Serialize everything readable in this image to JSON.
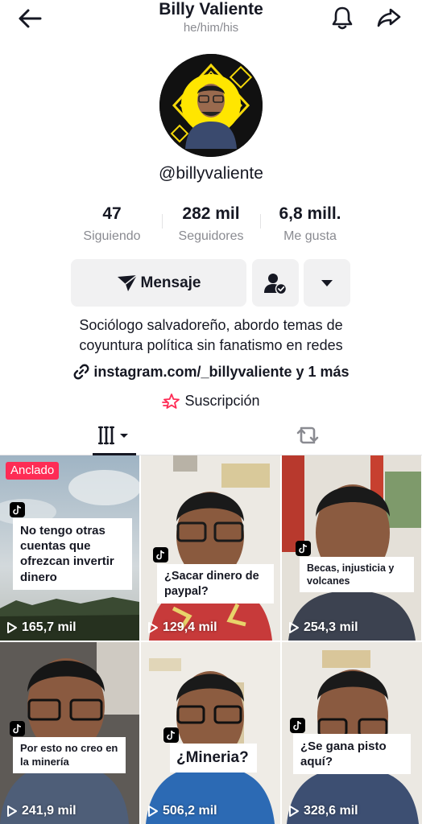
{
  "header": {
    "title": "Billy Valiente",
    "pronouns": "he/him/his",
    "back_icon": "arrow-left-icon",
    "bell_icon": "bell-icon",
    "share_icon": "share-arrow-icon"
  },
  "profile": {
    "username": "@billyvaliente",
    "stats": [
      {
        "value": "47",
        "label": "Siguiendo"
      },
      {
        "value": "282 mil",
        "label": "Seguidores"
      },
      {
        "value": "6,8 mill.",
        "label": "Me gusta"
      }
    ],
    "message_label": "Mensaje",
    "bio_line1": "Sociólogo salvadoreño, abordo temas de",
    "bio_line2": "coyuntura política sin fanatismo en redes",
    "link_text": "instagram.com/_billyvaliente y 1 más",
    "subscription_label": "Suscripción"
  },
  "colors": {
    "accent": "#fe2c55",
    "text": "#161823",
    "muted": "#8a8b91",
    "button_bg": "#f1f1f2"
  },
  "videos": [
    {
      "caption": "No tengo otras cuentas que ofrezcan invertir dinero",
      "views": "165,7 mil",
      "pinned_label": "Anclado"
    },
    {
      "caption": "¿Sacar dinero de paypal?",
      "views": "129,4 mil"
    },
    {
      "caption": "Becas, injusticia y volcanes",
      "views": "254,3 mil"
    },
    {
      "caption": "Por esto no creo en la minería",
      "views": "241,9 mil"
    },
    {
      "caption": "¿Mineria?",
      "views": "506,2 mil"
    },
    {
      "caption": "¿Se gana pisto aquí?",
      "views": "328,6 mil"
    }
  ]
}
